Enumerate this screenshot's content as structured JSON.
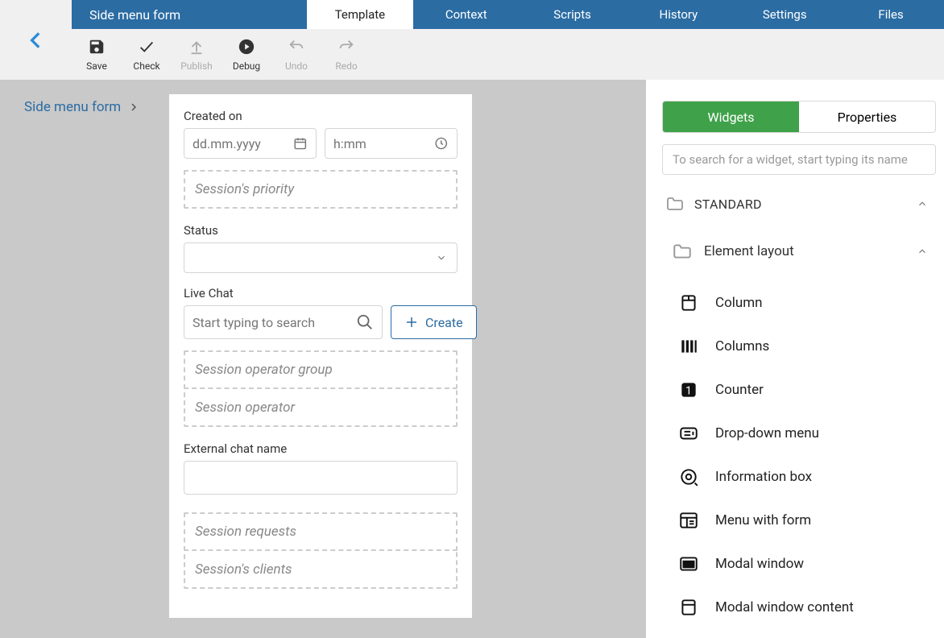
{
  "header": {
    "title": "Side menu form",
    "tabs": [
      "Template",
      "Context",
      "Scripts",
      "History",
      "Settings",
      "Files"
    ],
    "active_tab": "Template"
  },
  "toolbar": {
    "save": "Save",
    "check": "Check",
    "publish": "Publish",
    "debug": "Debug",
    "undo": "Undo",
    "redo": "Redo"
  },
  "breadcrumb": {
    "item": "Side menu form"
  },
  "form": {
    "created_on_label": "Created on",
    "date_placeholder": "dd.mm.yyyy",
    "time_placeholder": "h:mm",
    "priority_slot": "Session's priority",
    "status_label": "Status",
    "livechat_label": "Live Chat",
    "search_placeholder": "Start typing to search",
    "create_btn": "Create",
    "operator_group_slot": "Session operator group",
    "operator_slot": "Session operator",
    "external_name_label": "External chat name",
    "requests_slot": "Session requests",
    "clients_slot": "Session's clients"
  },
  "panel": {
    "tab_widgets": "Widgets",
    "tab_properties": "Properties",
    "search_placeholder": "To search for a widget, start typing its name",
    "section_standard": "STANDARD",
    "subsection_layout": "Element layout",
    "items": {
      "column": "Column",
      "columns": "Columns",
      "counter": "Counter",
      "dropdown": "Drop-down menu",
      "infobox": "Information box",
      "menuform": "Menu with form",
      "modal": "Modal window",
      "modalcontent": "Modal window content"
    }
  }
}
